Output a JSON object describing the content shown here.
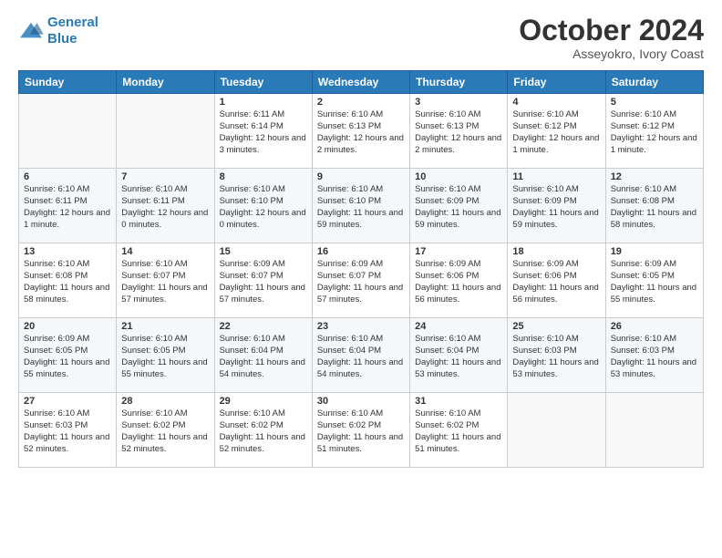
{
  "header": {
    "logo_line1": "General",
    "logo_line2": "Blue",
    "month": "October 2024",
    "location": "Asseyokro, Ivory Coast"
  },
  "weekdays": [
    "Sunday",
    "Monday",
    "Tuesday",
    "Wednesday",
    "Thursday",
    "Friday",
    "Saturday"
  ],
  "weeks": [
    [
      {
        "day": "",
        "info": ""
      },
      {
        "day": "",
        "info": ""
      },
      {
        "day": "1",
        "info": "Sunrise: 6:11 AM\nSunset: 6:14 PM\nDaylight: 12 hours and 3 minutes."
      },
      {
        "day": "2",
        "info": "Sunrise: 6:10 AM\nSunset: 6:13 PM\nDaylight: 12 hours and 2 minutes."
      },
      {
        "day": "3",
        "info": "Sunrise: 6:10 AM\nSunset: 6:13 PM\nDaylight: 12 hours and 2 minutes."
      },
      {
        "day": "4",
        "info": "Sunrise: 6:10 AM\nSunset: 6:12 PM\nDaylight: 12 hours and 1 minute."
      },
      {
        "day": "5",
        "info": "Sunrise: 6:10 AM\nSunset: 6:12 PM\nDaylight: 12 hours and 1 minute."
      }
    ],
    [
      {
        "day": "6",
        "info": "Sunrise: 6:10 AM\nSunset: 6:11 PM\nDaylight: 12 hours and 1 minute."
      },
      {
        "day": "7",
        "info": "Sunrise: 6:10 AM\nSunset: 6:11 PM\nDaylight: 12 hours and 0 minutes."
      },
      {
        "day": "8",
        "info": "Sunrise: 6:10 AM\nSunset: 6:10 PM\nDaylight: 12 hours and 0 minutes."
      },
      {
        "day": "9",
        "info": "Sunrise: 6:10 AM\nSunset: 6:10 PM\nDaylight: 11 hours and 59 minutes."
      },
      {
        "day": "10",
        "info": "Sunrise: 6:10 AM\nSunset: 6:09 PM\nDaylight: 11 hours and 59 minutes."
      },
      {
        "day": "11",
        "info": "Sunrise: 6:10 AM\nSunset: 6:09 PM\nDaylight: 11 hours and 59 minutes."
      },
      {
        "day": "12",
        "info": "Sunrise: 6:10 AM\nSunset: 6:08 PM\nDaylight: 11 hours and 58 minutes."
      }
    ],
    [
      {
        "day": "13",
        "info": "Sunrise: 6:10 AM\nSunset: 6:08 PM\nDaylight: 11 hours and 58 minutes."
      },
      {
        "day": "14",
        "info": "Sunrise: 6:10 AM\nSunset: 6:07 PM\nDaylight: 11 hours and 57 minutes."
      },
      {
        "day": "15",
        "info": "Sunrise: 6:09 AM\nSunset: 6:07 PM\nDaylight: 11 hours and 57 minutes."
      },
      {
        "day": "16",
        "info": "Sunrise: 6:09 AM\nSunset: 6:07 PM\nDaylight: 11 hours and 57 minutes."
      },
      {
        "day": "17",
        "info": "Sunrise: 6:09 AM\nSunset: 6:06 PM\nDaylight: 11 hours and 56 minutes."
      },
      {
        "day": "18",
        "info": "Sunrise: 6:09 AM\nSunset: 6:06 PM\nDaylight: 11 hours and 56 minutes."
      },
      {
        "day": "19",
        "info": "Sunrise: 6:09 AM\nSunset: 6:05 PM\nDaylight: 11 hours and 55 minutes."
      }
    ],
    [
      {
        "day": "20",
        "info": "Sunrise: 6:09 AM\nSunset: 6:05 PM\nDaylight: 11 hours and 55 minutes."
      },
      {
        "day": "21",
        "info": "Sunrise: 6:10 AM\nSunset: 6:05 PM\nDaylight: 11 hours and 55 minutes."
      },
      {
        "day": "22",
        "info": "Sunrise: 6:10 AM\nSunset: 6:04 PM\nDaylight: 11 hours and 54 minutes."
      },
      {
        "day": "23",
        "info": "Sunrise: 6:10 AM\nSunset: 6:04 PM\nDaylight: 11 hours and 54 minutes."
      },
      {
        "day": "24",
        "info": "Sunrise: 6:10 AM\nSunset: 6:04 PM\nDaylight: 11 hours and 53 minutes."
      },
      {
        "day": "25",
        "info": "Sunrise: 6:10 AM\nSunset: 6:03 PM\nDaylight: 11 hours and 53 minutes."
      },
      {
        "day": "26",
        "info": "Sunrise: 6:10 AM\nSunset: 6:03 PM\nDaylight: 11 hours and 53 minutes."
      }
    ],
    [
      {
        "day": "27",
        "info": "Sunrise: 6:10 AM\nSunset: 6:03 PM\nDaylight: 11 hours and 52 minutes."
      },
      {
        "day": "28",
        "info": "Sunrise: 6:10 AM\nSunset: 6:02 PM\nDaylight: 11 hours and 52 minutes."
      },
      {
        "day": "29",
        "info": "Sunrise: 6:10 AM\nSunset: 6:02 PM\nDaylight: 11 hours and 52 minutes."
      },
      {
        "day": "30",
        "info": "Sunrise: 6:10 AM\nSunset: 6:02 PM\nDaylight: 11 hours and 51 minutes."
      },
      {
        "day": "31",
        "info": "Sunrise: 6:10 AM\nSunset: 6:02 PM\nDaylight: 11 hours and 51 minutes."
      },
      {
        "day": "",
        "info": ""
      },
      {
        "day": "",
        "info": ""
      }
    ]
  ]
}
